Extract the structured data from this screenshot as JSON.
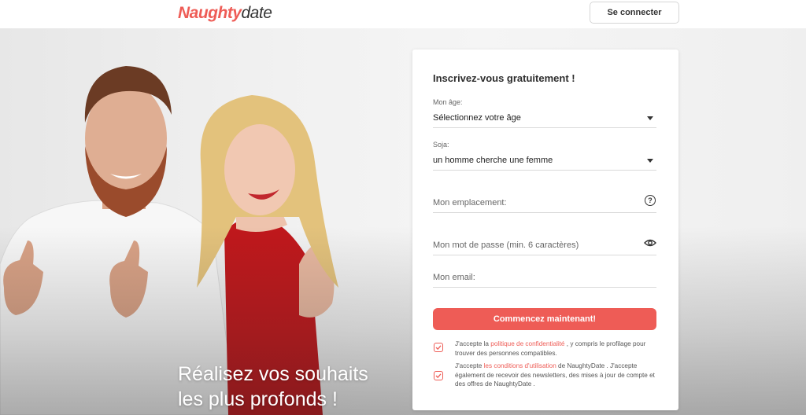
{
  "header": {
    "logo_part1": "Naughty",
    "logo_part2": "date",
    "login_label": "Se connecter"
  },
  "hero": {
    "tagline_line1": "Réalisez vos souhaits",
    "tagline_line2": "les plus profonds !"
  },
  "form": {
    "title": "Inscrivez-vous gratuitement !",
    "age_label": "Mon âge:",
    "age_value": "Sélectionnez votre âge",
    "seek_label": "Soja:",
    "seek_value": "un homme cherche une femme",
    "location_placeholder": "Mon emplacement:",
    "password_placeholder": "Mon mot de passe (min. 6 caractères)",
    "email_placeholder": "Mon email:",
    "submit_label": "Commencez maintenant!",
    "consent1_pre": "J'accepte la ",
    "consent1_link": "politique de confidentialité",
    "consent1_post": " , y compris le profilage pour trouver des personnes compatibles.",
    "consent2_pre": "J'accepte ",
    "consent2_link": "les conditions d'utilisation",
    "consent2_post": " de NaughtyDate . J'accepte également de recevoir des newsletters, des mises à jour de compte et des offres de NaughtyDate ."
  },
  "colors": {
    "accent": "#ee5c56",
    "text_dark": "#2d2d2d"
  },
  "icons": [
    "chevron-down-icon",
    "help-icon",
    "eye-icon",
    "checkmark-icon"
  ]
}
